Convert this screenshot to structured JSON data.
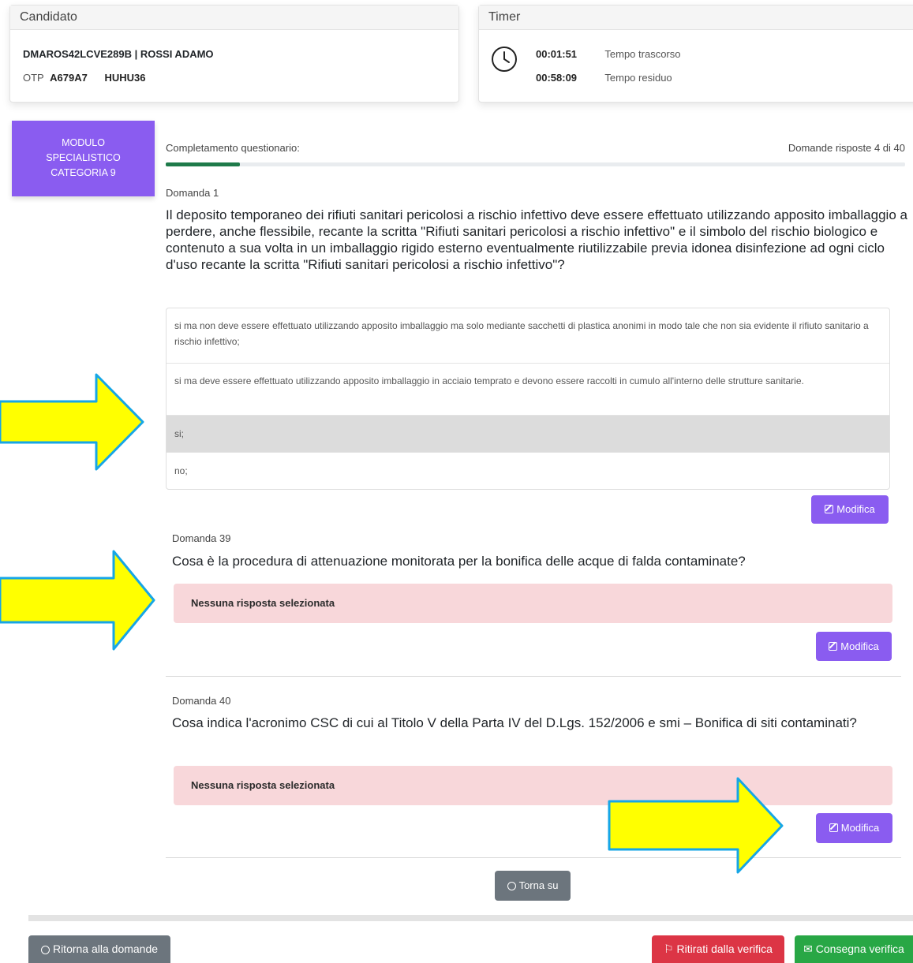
{
  "candidate": {
    "header": "Candidato",
    "id_name": "DMAROS42LCVE289B | ROSSI ADAMO",
    "otp_label": "OTP",
    "otp_code": "A679A7",
    "otp_code2": "HUHU36"
  },
  "timer": {
    "header": "Timer",
    "elapsed_value": "00:01:51",
    "elapsed_label": "Tempo trascorso",
    "remaining_value": "00:58:09",
    "remaining_label": "Tempo residuo"
  },
  "module": {
    "line1": "Modulo",
    "line2": "Specialistico",
    "line3": "Categoria 9"
  },
  "progress": {
    "label": "Completamento questionario:",
    "count_text": "Domande risposte 4 di 40",
    "answered": 4,
    "total": 40
  },
  "questions": [
    {
      "number_label": "Domanda 1",
      "text": "Il deposito temporaneo dei rifiuti sanitari pericolosi a rischio infettivo deve essere effettuato utilizzando apposito imballaggio a perdere, anche flessibile, recante la scritta \"Rifiuti sanitari pericolosi a rischio infettivo\" e il simbolo del rischio biologico e contenuto a sua volta in un imballaggio rigido esterno eventualmente riutilizzabile previa idonea disinfezione ad ogni ciclo d'uso recante la scritta \"Rifiuti sanitari pericolosi a rischio infettivo\"?",
      "answers": [
        "si ma non deve essere effettuato utilizzando apposito imballaggio ma solo mediante sacchetti di plastica anonimi in modo tale che non sia evidente il rifiuto sanitario a rischio infettivo;",
        "si ma deve essere effettuato utilizzando apposito imballaggio in acciaio temprato e devono essere raccolti in cumulo all'interno delle strutture sanitarie.",
        "si;",
        "no;"
      ],
      "selected_index": 2,
      "edit_label": "Modifica"
    },
    {
      "number_label": "Domanda 39",
      "text": "Cosa è la procedura di attenuazione monitorata per la bonifica delle acque di falda contaminate?",
      "no_answer": "Nessuna risposta selezionata",
      "edit_label": "Modifica"
    },
    {
      "number_label": "Domanda 40",
      "text": "Cosa indica l'acronimo CSC di cui al Titolo V della Parta IV del D.Lgs. 152/2006 e smi – Bonifica di siti contaminati?",
      "no_answer": "Nessuna risposta selezionata",
      "edit_label": "Modifica"
    }
  ],
  "buttons": {
    "back_top": "Torna su",
    "return": "Ritorna alla domande",
    "withdraw": "Ritirati dalla verifica",
    "submit": "Consegna verifica"
  },
  "colors": {
    "accent_purple": "#8a5cf0",
    "progress_green": "#1e7a4a",
    "no_answer_bg": "#f8d7da",
    "danger_red": "#dc3545",
    "success_green": "#28a745",
    "secondary_gray": "#6c757d",
    "arrow_yellow": "#ffff00",
    "arrow_outline": "#16a6e6"
  }
}
